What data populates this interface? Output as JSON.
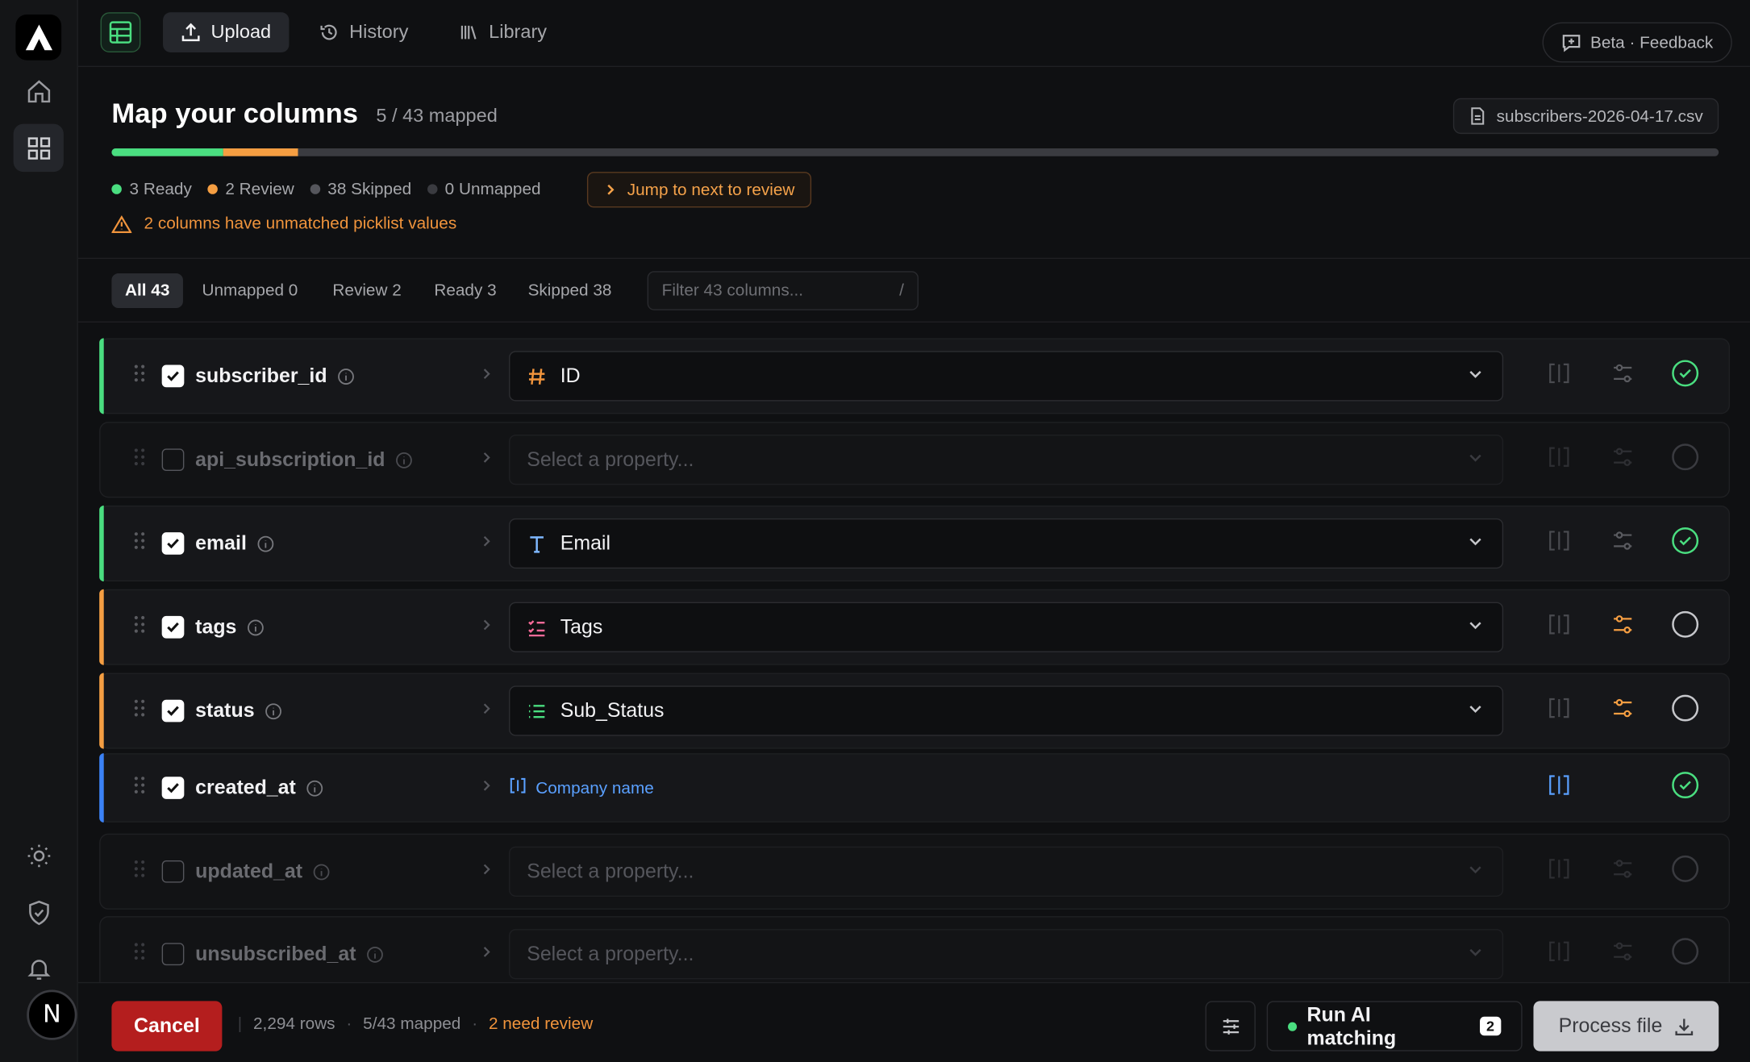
{
  "topbar": {
    "tabs": [
      {
        "label": "Upload",
        "icon": "upload-icon",
        "active": true
      },
      {
        "label": "History",
        "icon": "history-icon",
        "active": false
      },
      {
        "label": "Library",
        "icon": "library-icon",
        "active": false
      }
    ],
    "feedback_label": "Beta · Feedback"
  },
  "header": {
    "title": "Map your columns",
    "mapped_count": "5 / 43 mapped",
    "file_name": "subscribers-2026-04-17.csv",
    "progress": {
      "ready": 3,
      "review": 2,
      "total": 43
    },
    "legend": [
      {
        "label": "3 Ready",
        "color": "#4ade80"
      },
      {
        "label": "2 Review",
        "color": "#f59e42"
      },
      {
        "label": "38 Skipped",
        "color": "#55565c"
      },
      {
        "label": "0 Unmapped",
        "color": "#3a3b40"
      }
    ],
    "jump_label": "Jump to next to review",
    "warning": "2 columns have unmatched picklist values"
  },
  "filters": {
    "tabs": [
      "All 43",
      "Unmapped 0",
      "Review 2",
      "Ready 3",
      "Skipped 38"
    ],
    "search_placeholder": "Filter 43 columns...",
    "search_shortcut": "/"
  },
  "rows": [
    {
      "name": "subscriber_id",
      "checked": true,
      "status": "ready",
      "accent": "#4ade80",
      "property": "ID",
      "type_icon": "hash-icon"
    },
    {
      "name": "api_subscription_id",
      "checked": false,
      "status": "skipped",
      "accent": null,
      "property": "Select a property..."
    },
    {
      "name": "email",
      "checked": true,
      "status": "ready",
      "accent": "#4ade80",
      "property": "Email",
      "type_icon": "text-icon"
    },
    {
      "name": "tags",
      "checked": true,
      "status": "review",
      "accent": "#f59e42",
      "property": "Tags",
      "type_icon": "checklist-icon"
    },
    {
      "name": "status",
      "checked": true,
      "status": "review",
      "accent": "#f59e42",
      "property": "Sub_Status",
      "type_icon": "list-icon"
    },
    {
      "name": "created_at",
      "checked": true,
      "status": "ready",
      "accent": "#3b82f6",
      "property": "Company name",
      "type_icon": "combine-icon"
    },
    {
      "name": "updated_at",
      "checked": false,
      "status": "skipped",
      "accent": null,
      "property": "Select a property..."
    },
    {
      "name": "unsubscribed_at",
      "checked": false,
      "status": "skipped",
      "accent": null,
      "property": "Select a property..."
    }
  ],
  "footer": {
    "cancel_label": "Cancel",
    "rows": "2,294 rows",
    "mapped": "5/43 mapped",
    "review": "2 need review",
    "ai_label": "Run AI matching",
    "ai_badge": "2",
    "process_label": "Process file"
  },
  "avatar": "N",
  "colors": {
    "ready": "#4ade80",
    "review": "#f59e42",
    "link": "#5aa0ff",
    "danger": "#b41e1e"
  }
}
